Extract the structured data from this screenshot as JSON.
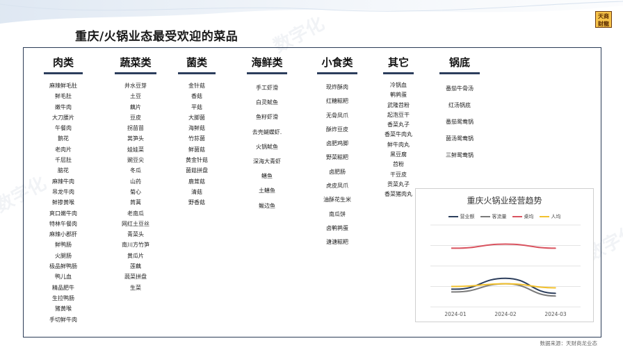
{
  "page": {
    "title": "重庆/火锅业态最受欢迎的菜品",
    "logo_lines": [
      "天商",
      "财龍"
    ],
    "watermark": "数字化",
    "source": "数据来源：天财商龙业态"
  },
  "categories": [
    {
      "name": "肉类",
      "items": [
        "麻辣鲜毛肚",
        "鲜毛肚",
        "嫩牛肉",
        "大刀腰片",
        "午餐肉",
        "鹅花",
        "老肉片",
        "千层肚",
        "脑花",
        "麻辣牛肉",
        "吊龙牛肉",
        "鲜掺黄喉",
        "爽口嫩牛肉",
        "特林午餐肉",
        "麻辣小郡肝",
        "鲜鸭肠",
        "火腿肠",
        "极品鲜鸭肠",
        "鸭儿血",
        "精品肥牛",
        "生拉鸭肠",
        "猪黄喉",
        "手切鲜牛肉"
      ]
    },
    {
      "name": "蔬菜类",
      "items": [
        "井水豆芽",
        "土豆",
        "藕片",
        "豆皮",
        "拐苗苗",
        "莴笋头",
        "娃娃菜",
        "豌豆尖",
        "冬瓜",
        "山药",
        "菊心",
        "茼蒿",
        "老南瓜",
        "网红土豆丝",
        "青菜头",
        "南川方竹笋",
        "黄瓜片",
        "莲藕",
        "蔬菜拼盘",
        "生菜"
      ]
    },
    {
      "name": "菌类",
      "items": [
        "金针菇",
        "香菇",
        "平菇",
        "大脚菌",
        "海鲜菇",
        "竹荪菌",
        "鲜菌菇",
        "黄金针菇",
        "菌菇拼盘",
        "鹿茸菇",
        "清菇",
        "野香菇"
      ]
    },
    {
      "name": "海鲜类",
      "items": [
        "手工虾滑",
        "白灵鱿鱼",
        "鱼籽虾滑",
        "去壳蝴蝶虾.",
        "火锅鱿鱼",
        "深海大青虾",
        "鳝鱼",
        "土鳝鱼",
        "鲅边鱼"
      ]
    },
    {
      "name": "小食类",
      "items": [
        "现炸酥肉",
        "红糖糍粑",
        "无骨凤爪",
        "酥炸豆皮",
        "卤肥鸡脚",
        "野菜糍粑",
        "卤肥肠",
        "虎皮凤爪",
        "油酥花生米",
        "南瓜饼",
        "卤鹌鹑蛋",
        "溏溏糍粑"
      ]
    },
    {
      "name": "其它",
      "items": [
        "冷锅血",
        "鹌鹑蛋",
        "武隆苕粉",
        "起泡豆干",
        "香菜丸子",
        "香菜牛肉丸",
        "鲜牛肉丸",
        "黑豆腐",
        "苕粉",
        "干豆皮",
        "贡菜丸子",
        "香菜猪肉丸"
      ]
    },
    {
      "name": "锅底",
      "items": [
        "番茄牛骨汤",
        "红汤锅底",
        "番茄鸳鸯锅",
        "菌汤鸳鸯锅",
        "三鲜鸳鸯锅"
      ]
    }
  ],
  "chart_data": {
    "type": "line",
    "title": "重庆火锅业经营趋势",
    "categories": [
      "2024-01",
      "2024-02",
      "2024-03"
    ],
    "series": [
      {
        "name": "营业额",
        "color": "#2c3e5c",
        "values": [
          0.98,
          1.06,
          0.95
        ]
      },
      {
        "name": "客流量",
        "color": "#7a7a7a",
        "values": [
          0.96,
          1.02,
          0.93
        ]
      },
      {
        "name": "桌均",
        "color": "#d9535f",
        "values": [
          1.28,
          1.31,
          1.28
        ]
      },
      {
        "name": "人均",
        "color": "#f2c12e",
        "values": [
          1.0,
          1.02,
          0.99
        ]
      }
    ],
    "ylim": [
      0.85,
      1.45
    ],
    "grid": true,
    "legend": "top"
  }
}
